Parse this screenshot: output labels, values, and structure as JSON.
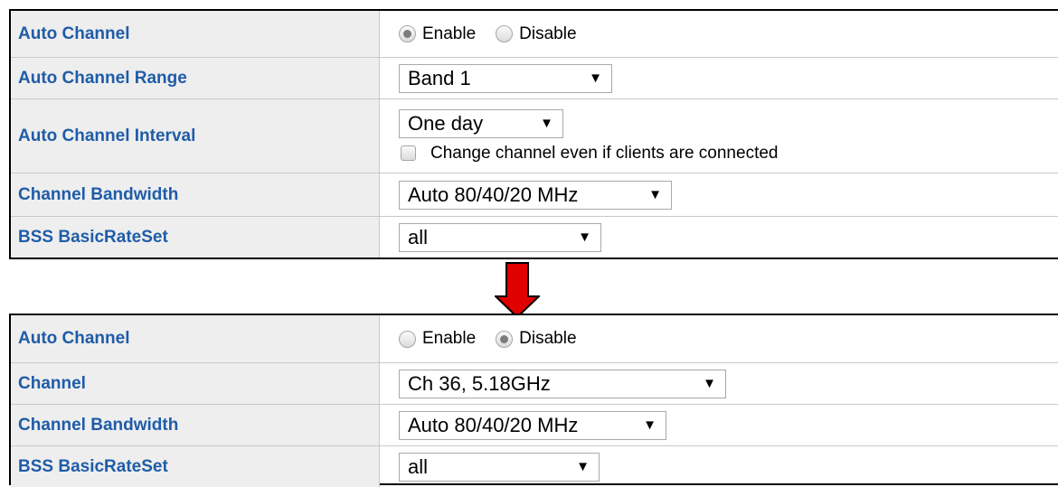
{
  "before_panel": {
    "auto_channel": {
      "label": "Auto Channel",
      "options": [
        "Enable",
        "Disable"
      ],
      "selected": "Enable"
    },
    "auto_channel_range": {
      "label": "Auto Channel Range",
      "value": "Band 1"
    },
    "auto_channel_interval": {
      "label": "Auto Channel Interval",
      "value": "One day",
      "checkbox_label": "Change channel even if clients are connected",
      "checkbox_checked": false
    },
    "channel_bandwidth": {
      "label": "Channel Bandwidth",
      "value": "Auto 80/40/20 MHz"
    },
    "bss_basic_rate_set": {
      "label": "BSS BasicRateSet",
      "value": "all"
    }
  },
  "transition_arrow": {
    "icon": "arrow-down-icon",
    "color": "#e00000"
  },
  "after_panel": {
    "auto_channel": {
      "label": "Auto Channel",
      "options": [
        "Enable",
        "Disable"
      ],
      "selected": "Disable"
    },
    "channel": {
      "label": "Channel",
      "value": "Ch 36, 5.18GHz"
    },
    "channel_bandwidth": {
      "label": "Channel Bandwidth",
      "value": "Auto 80/40/20 MHz"
    },
    "bss_basic_rate_set": {
      "label": "BSS BasicRateSet",
      "value": "all"
    }
  },
  "colors": {
    "label_text": "#1f5ca8",
    "label_bg": "#eeeeee",
    "border": "#c9c9c9"
  },
  "dropdown_arrow": "▼"
}
